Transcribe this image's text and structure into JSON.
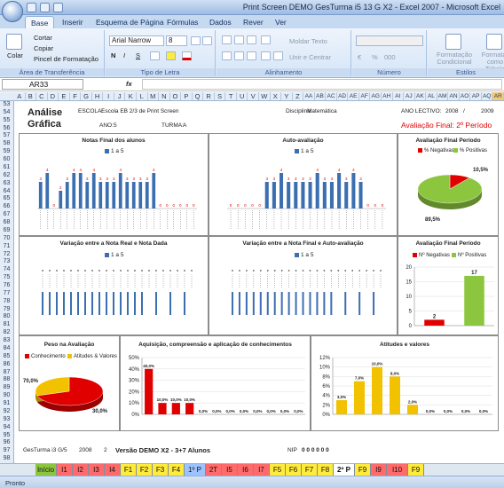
{
  "window": {
    "title": "Print Screen DEMO GesTurma i5 13 G X2 - Excel 2007 - Microsoft Excel"
  },
  "ribbon": {
    "tabs": [
      "Base",
      "Inserir",
      "Esquema de Página",
      "Fórmulas",
      "Dados",
      "Rever",
      "Ver"
    ],
    "clipboard": {
      "paste": "Colar",
      "cut": "Cortar",
      "copy": "Copiar",
      "format_painter": "Pincel de Formatação",
      "group": "Área de Transferência"
    },
    "font": {
      "name": "Arial Narrow",
      "size": "8",
      "bold": "N",
      "italic": "I",
      "underline": "S",
      "group": "Tipo de Letra"
    },
    "alignment": {
      "wrap": "Moldar Texto",
      "merge": "Unir e Centrar",
      "group": "Alinhamento"
    },
    "number": {
      "currency": "€",
      "percent": "%",
      "thousands": "000",
      "group": "Número"
    },
    "styles": {
      "conditional": "Formatação Condicional",
      "table": "Formatar como Tabela",
      "group": "Estilos"
    }
  },
  "formula_bar": {
    "name_box": "AR33",
    "fx": "fx",
    "content": ""
  },
  "columns": [
    "A",
    "B",
    "C",
    "D",
    "E",
    "F",
    "G",
    "H",
    "I",
    "J",
    "K",
    "L",
    "M",
    "N",
    "O",
    "P",
    "Q",
    "R",
    "S",
    "T",
    "U",
    "V",
    "W",
    "X",
    "Y",
    "Z",
    "AA",
    "AB",
    "AC",
    "AD",
    "AE",
    "AF",
    "AG",
    "AH",
    "AI",
    "AJ",
    "AK",
    "AL",
    "AM",
    "AN",
    "AO",
    "AP",
    "AQ",
    "AR"
  ],
  "rows": [
    "53",
    "54",
    "55",
    "56",
    "57",
    "58",
    "59",
    "60",
    "61",
    "62",
    "63",
    "64",
    "65",
    "66",
    "67",
    "68",
    "69",
    "70",
    "71",
    "72",
    "73",
    "74",
    "75",
    "76",
    "77",
    "78",
    "79",
    "80",
    "81",
    "82",
    "83",
    "84",
    "85",
    "86",
    "87",
    "88",
    "89",
    "90",
    "91",
    "92",
    "93",
    "94",
    "95",
    "96",
    "97",
    "98"
  ],
  "header": {
    "title1": "Análise",
    "title2": "Gráfica",
    "escola_label": "ESCOLA:",
    "escola": "Escola EB 2/3 de Print Screen",
    "disciplina_label": "Disciplina:",
    "disciplina": "Matemática",
    "ano_lectivo_label": "ANO LECTIVO:",
    "ano_start": "2008",
    "ano_sep": "/",
    "ano_end": "2009",
    "ano_label": "ANO:",
    "ano": "5",
    "turma_label": "TURMA:",
    "turma": "A",
    "periodo": "Avaliação Final: 2º Período"
  },
  "charts": {
    "notas_final": {
      "title": "Notas Final dos alunos",
      "legend": "1 a 5"
    },
    "autoavaliacao": {
      "title": "Auto-avaliação",
      "legend": "1 a 5"
    },
    "avaliacao_final": {
      "title": "Avaliação Final Período",
      "legend_neg": "% Negativas",
      "legend_pos": "% Positivas",
      "label_neg": "10,5%",
      "label_pos": "89,5%"
    },
    "var_nota_dada": {
      "title": "Variação entre a Nota Real e Nota Dada",
      "legend": "1 a 5"
    },
    "var_nota_auto": {
      "title": "Variação entre a Nota Final e Auto-avaliação",
      "legend": "1 a 5"
    },
    "avaliacao_final_num": {
      "title": "Avaliação Final Período",
      "legend_neg": "Nº Negativas",
      "legend_pos": "Nº Positivas"
    },
    "peso": {
      "title": "Peso na Avaliação",
      "legend_a": "Conhecimento",
      "legend_b": "Atitudes & Valores",
      "label_a": "30,0%",
      "label_b": "70,0%"
    },
    "aquisicao": {
      "title": "Aquisição, compreensão e aplicação de conhecimentos"
    },
    "atitudes": {
      "title": "Atitudes e valores"
    }
  },
  "chart_data": [
    {
      "type": "bar",
      "title": "Avaliação Final Período",
      "categories": [
        "Nº Negativas",
        "Nº Positivas"
      ],
      "values": [
        2,
        17
      ],
      "ylim": [
        0,
        20
      ],
      "colors": [
        "#e00000",
        "#8cc63f"
      ]
    },
    {
      "type": "pie",
      "title": "Avaliação Final Período",
      "categories": [
        "% Negativas",
        "% Positivas"
      ],
      "values": [
        10.5,
        89.5
      ],
      "colors": [
        "#e00000",
        "#8cc63f"
      ]
    },
    {
      "type": "pie",
      "title": "Peso na Avaliação",
      "categories": [
        "Conhecimento",
        "Atitudes & Valores"
      ],
      "values": [
        70,
        30
      ],
      "colors": [
        "#e00000",
        "#f2c200"
      ]
    },
    {
      "type": "bar",
      "title": "Aquisição, compreensão e aplicação de conhecimentos",
      "values": [
        40,
        10,
        10,
        10,
        0,
        0,
        0,
        0,
        0,
        0,
        0,
        0
      ],
      "labels": [
        "40,0%",
        "10,0%",
        "10,0%",
        "10,0%",
        "0,0%",
        "0,0%",
        "0,0%",
        "0,0%",
        "0,0%",
        "0,0%",
        "0,0%",
        "0,0%"
      ],
      "ylim": [
        0,
        50
      ],
      "yticks": [
        "0%",
        "10%",
        "20%",
        "30%",
        "40%",
        "50%"
      ],
      "color": "#e00000"
    },
    {
      "type": "bar",
      "title": "Atitudes e valores",
      "values": [
        3,
        7,
        10,
        8,
        2,
        0,
        0,
        0,
        0
      ],
      "labels": [
        "3,0%",
        "7,0%",
        "10,0%",
        "8,0%",
        "2,0%",
        "0,0%",
        "0,0%",
        "0,0%",
        "0,0%"
      ],
      "ylim": [
        0,
        12
      ],
      "yticks": [
        "0%",
        "2%",
        "4%",
        "6%",
        "8%",
        "10%",
        "12%"
      ],
      "color": "#f2c200"
    },
    {
      "type": "bar",
      "title": "Notas Final dos alunos",
      "values": [
        3,
        4,
        0,
        2,
        3,
        4,
        4,
        3,
        4,
        3,
        3,
        3,
        4,
        3,
        3,
        3,
        3,
        4,
        0,
        0,
        0,
        0,
        0,
        0
      ],
      "ylim": [
        0,
        5
      ],
      "color": "#3c6fb0"
    },
    {
      "type": "bar",
      "title": "Auto-avaliação",
      "values": [
        0,
        0,
        0,
        0,
        0,
        3,
        3,
        4,
        3,
        3,
        3,
        3,
        4,
        3,
        3,
        4,
        3,
        4,
        3,
        0,
        0,
        0
      ],
      "ylim": [
        0,
        5
      ],
      "color": "#3c6fb0"
    }
  ],
  "footer": {
    "left": "GesTurma i3 G/5",
    "year": "2008",
    "n": "2",
    "demo": "Versão DEMO X2 - 3+7 Alunos",
    "nip_label": "NIP",
    "nip": "0 0 0 0 0 0"
  },
  "sheet_tabs": [
    "Início",
    "I1",
    "I2",
    "I3",
    "I4",
    "F1",
    "F2",
    "F3",
    "F4",
    "1º P",
    "2T",
    "I5",
    "I6",
    "I7",
    "F5",
    "F6",
    "F7",
    "F8",
    "2º P",
    "F9",
    "I9",
    "I10",
    "F9"
  ],
  "status": {
    "mode": "Pronto"
  }
}
